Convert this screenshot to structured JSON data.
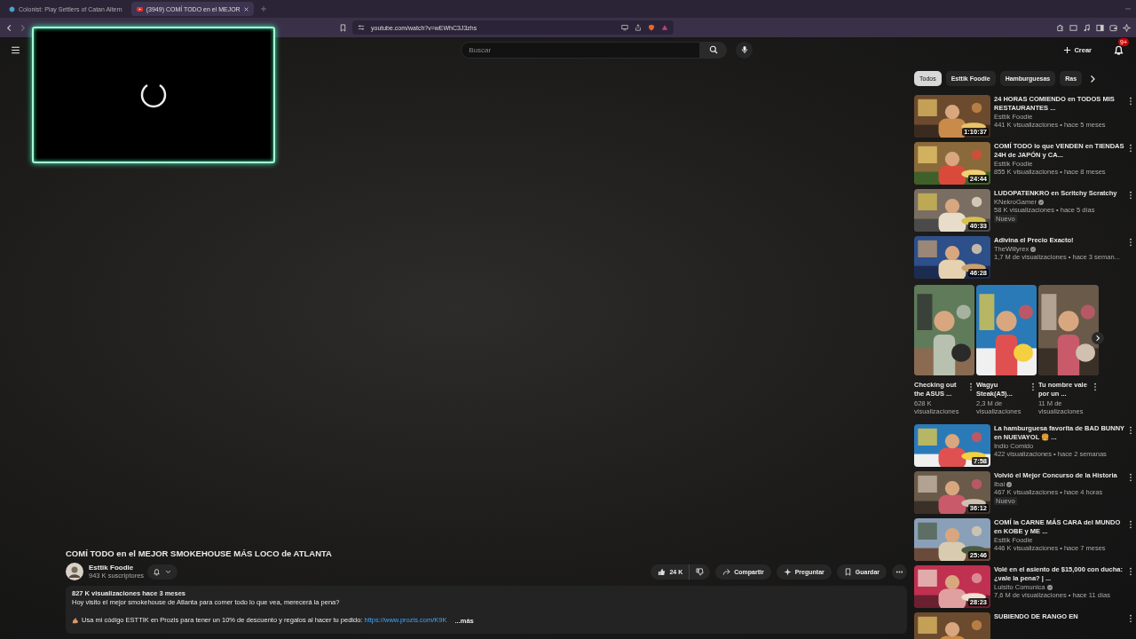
{
  "browser": {
    "tabs": [
      {
        "title": "Colonist: Play Settlers of Catan Altern",
        "selected": false
      },
      {
        "title": "(3949) COMÍ TODO en el MEJOR",
        "selected": true
      }
    ],
    "url": "youtube.com/watch?v=wEWhC3J3zhs"
  },
  "header": {
    "search": {
      "placeholder": "Buscar"
    },
    "create": "Crear",
    "notifications": "9+"
  },
  "chips": [
    {
      "label": "Todos",
      "selected": true
    },
    {
      "label": "Esttik Foodie",
      "selected": false
    },
    {
      "label": "Hamburguesas",
      "selected": false
    },
    {
      "label": "Ras",
      "selected": false
    }
  ],
  "recommendations_top": [
    {
      "title": "24 HORAS COMIENDO en TODOS MIS RESTAURANTES ...",
      "channel": "Esttik Foodie",
      "verified": false,
      "meta": "441 K visualizaciones • hace 5 meses",
      "duration": "1:10:37",
      "new": false
    },
    {
      "title": "COMÍ TODO lo que VENDEN en TIENDAS 24H de JAPÓN y CA...",
      "channel": "Esttik Foodie",
      "verified": false,
      "meta": "855 K visualizaciones • hace 8 meses",
      "duration": "24:44",
      "new": false
    },
    {
      "title": "LUDOPATENKRO en Scritchy Scratchy",
      "channel": "KNekroGamer",
      "verified": true,
      "meta": "58 K visualizaciones • hace 5 días",
      "duration": "40:33",
      "new": true,
      "new_label": "Nuevo"
    },
    {
      "title": "Adivina el Precio Exacto!",
      "channel": "TheWillyrex",
      "verified": true,
      "meta": "1,7 M de visualizaciones • hace 3 seman...",
      "duration": "46:28",
      "new": false
    }
  ],
  "shorts": [
    {
      "title": "Checking out the ASUS ...",
      "views": "628 K visualizaciones"
    },
    {
      "title": "Wagyu Steak(A5)...",
      "views": "2,3 M de visualizaciones"
    },
    {
      "title": "Tu nombre vale por un ...",
      "views": "11 M de visualizaciones"
    }
  ],
  "recommendations_bottom": [
    {
      "title": "La hamburguesa favorita de BAD BUNNY en NUEVAYOL 🍔 ...",
      "channel": "Indio Comido",
      "verified": false,
      "meta": "422 visualizaciones • hace 2 semanas",
      "duration": "7:58",
      "new": false
    },
    {
      "title": "Volvió el Mejor Concurso de la Historia",
      "channel": "Ibai",
      "verified": true,
      "meta": "467 K visualizaciones • hace 4 horas",
      "duration": "36:12",
      "new": true,
      "new_label": "Nuevo"
    },
    {
      "title": "COMÍ la CARNE MÁS CARA del MUNDO en KOBE y ME ...",
      "channel": "Esttik Foodie",
      "verified": false,
      "meta": "446 K visualizaciones • hace 7 meses",
      "duration": "25:46",
      "new": false
    },
    {
      "title": "Volé en el asiento de $15,000 con ducha: ¿vale la pena? | ...",
      "channel": "Luisito Comunica",
      "verified": true,
      "meta": "7,6 M de visualizaciones • hace 11 días",
      "duration": "28:23",
      "new": false
    },
    {
      "title": "SUBIENDO DE RANGO EN",
      "new": false
    }
  ],
  "video": {
    "title": "COMÍ TODO en el MEJOR SMOKEHOUSE MÁS LOCO de ATLANTA",
    "channel": "Esttik Foodie",
    "subscribers": "943 K suscriptores",
    "likes": "24 K",
    "actions": [
      "Compartir",
      "Preguntar",
      "Guardar"
    ],
    "description": {
      "stats": "827 K visualizaciones  hace 3 meses",
      "line1": "Hoy visito el mejor smokehouse de Atlanta para comer todo lo que vea, merecerá la pena?",
      "line2": "Usa mi código ESTTIK en Prozis para tener un 10% de descuento y regalos al hacer tu pedido: ",
      "link": "https://www.prozis.com/K9K",
      "more": "...más"
    }
  }
}
